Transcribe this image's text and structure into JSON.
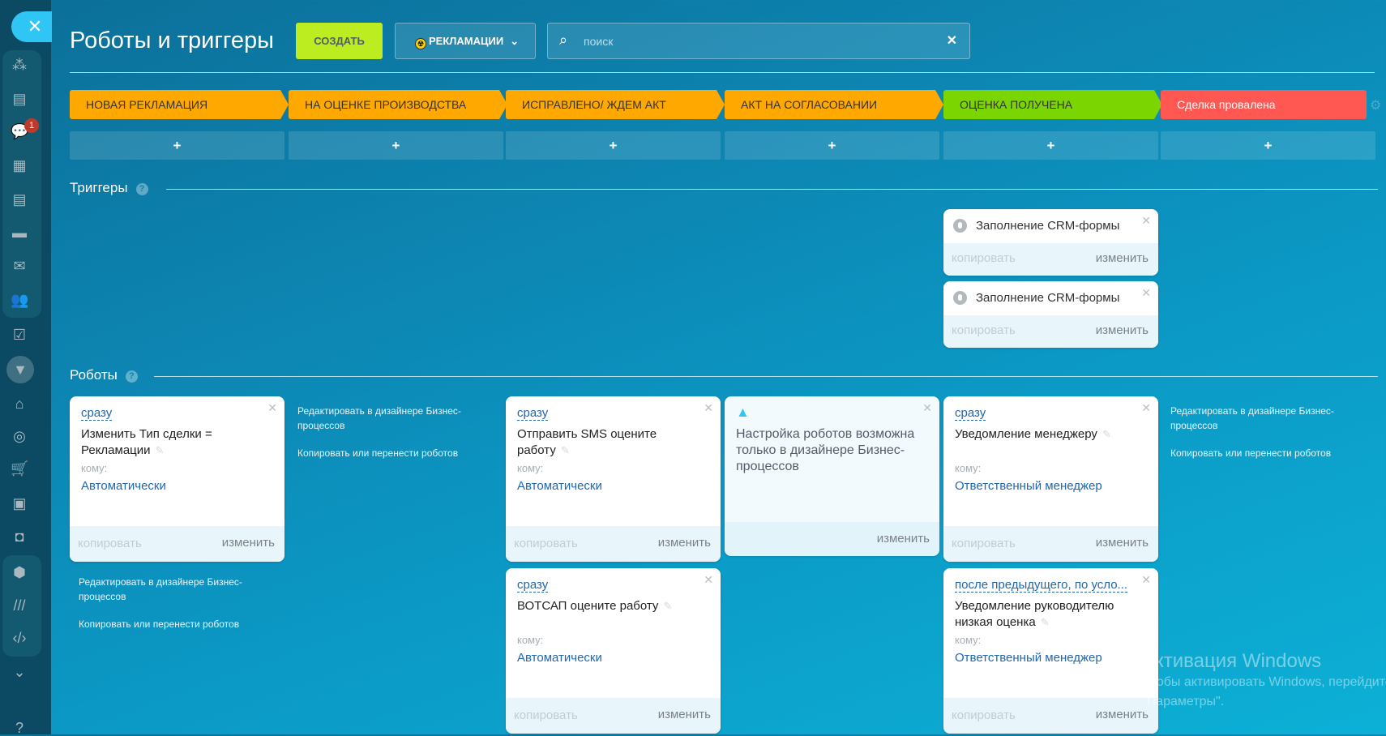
{
  "header": {
    "title": "Роботы и триггеры",
    "create_label": "СОЗДАТЬ",
    "category_label": "РЕКЛАМАЦИИ",
    "search_placeholder": "поиск"
  },
  "sidebar": {
    "chat_badge": "1"
  },
  "stages": [
    {
      "label": "НОВАЯ РЕКЛАМАЦИЯ",
      "color": "#ffa900",
      "text": "#333333"
    },
    {
      "label": "НА ОЦЕНКЕ ПРОИЗВОДСТВА",
      "color": "#ffa900",
      "text": "#333333"
    },
    {
      "label": "ИСПРАВЛЕНО/ ЖДЕМ АКТ",
      "color": "#ffa900",
      "text": "#333333"
    },
    {
      "label": "АКТ НА СОГЛАСОВАНИИ",
      "color": "#ffa900",
      "text": "#333333"
    },
    {
      "label": "ОЦЕНКА ПОЛУЧЕНА",
      "color": "#7bd500",
      "text": "#333333"
    },
    {
      "label": "Сделка провалена",
      "color": "#ff5752",
      "text": "#ffffff"
    }
  ],
  "add_label": "+",
  "sections": {
    "triggers": "Триггеры",
    "robots": "Роботы",
    "help": "?"
  },
  "common": {
    "copy": "копировать",
    "edit": "изменить",
    "to": "кому:",
    "edit_designer": "Редактировать в дизайнере Бизнес-процессов",
    "copy_move": "Копировать или перенести роботов"
  },
  "triggers": [
    {
      "title": "Заполнение CRM-формы"
    },
    {
      "title": "Заполнение CRM-формы"
    }
  ],
  "robots": [
    {
      "col": 0,
      "when": "сразу",
      "title": "Изменить Тип сделки = Рекламации",
      "to": "Автоматически"
    },
    {
      "col": 2,
      "when": "сразу",
      "title": "Отправить SMS оцените работу",
      "to": "Автоматически"
    },
    {
      "col": 2,
      "when": "сразу",
      "title": "ВОТСАП оцените работу",
      "to": "Автоматически"
    },
    {
      "col": 4,
      "when": "сразу",
      "title": "Уведомление менеджеру",
      "to": "Ответственный менеджер"
    },
    {
      "col": 4,
      "when": "после предыдущего, по усло...",
      "title": "Уведомление руководителю низкая оценка",
      "to": "Ответственный менеджер"
    }
  ],
  "warning": {
    "text": "Настройка роботов возможна только в дизайнере Бизнес-процессов"
  },
  "watermark": {
    "title": "Активация Windows",
    "line1": "Чтобы активировать Windows, перейдите в раздел",
    "line2": "\"Параметры\"."
  }
}
